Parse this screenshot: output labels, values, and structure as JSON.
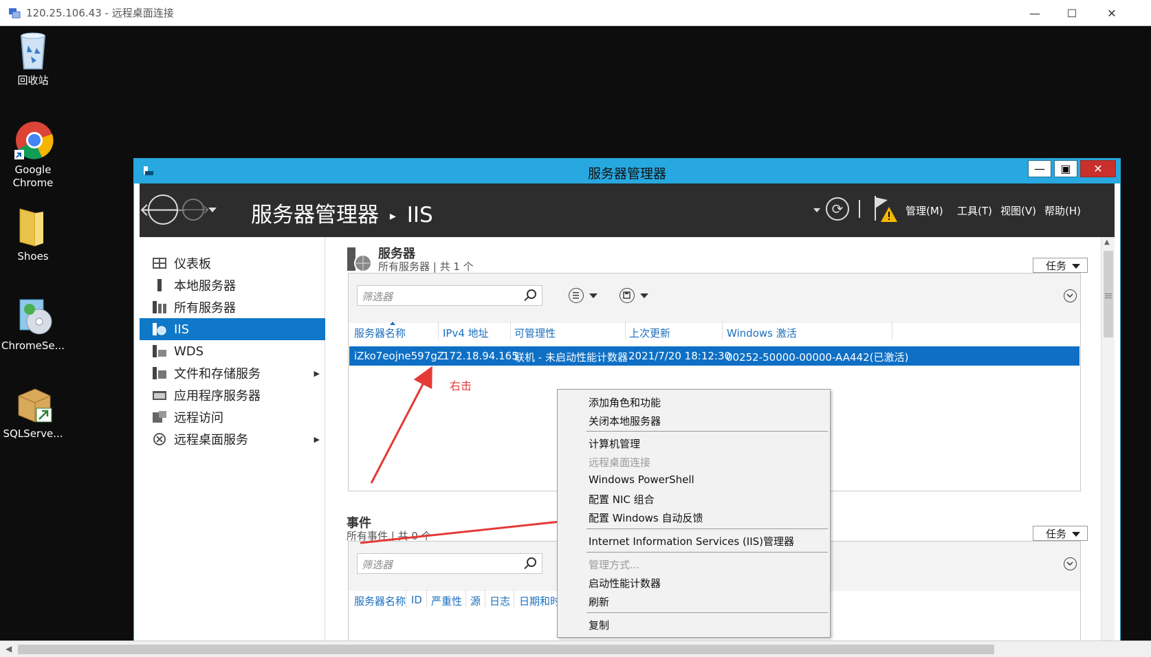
{
  "rdp": {
    "title": "120.25.106.43 - 远程桌面连接"
  },
  "desktop_icons": [
    {
      "label": "回收站",
      "icon": "recycle-bin-icon"
    },
    {
      "label": "Google\nChrome",
      "line1": "Google",
      "line2": "Chrome",
      "icon": "chrome-icon"
    },
    {
      "label": "Shoes",
      "icon": "folder-icon"
    },
    {
      "label": "ChromeSe...",
      "icon": "chromesetup-icon"
    },
    {
      "label": "SQLServe...",
      "icon": "sqlserver-icon"
    }
  ],
  "window": {
    "title": "服务器管理器"
  },
  "header": {
    "breadcrumb_root": "服务器管理器",
    "breadcrumb_sep": "▸",
    "breadcrumb_current": "IIS",
    "menu": {
      "manage": "管理(M)",
      "tools": "工具(T)",
      "view": "视图(V)",
      "help": "帮助(H)"
    }
  },
  "sidebar": {
    "items": [
      {
        "label": "仪表板",
        "icon": "dashboard-icon"
      },
      {
        "label": "本地服务器",
        "icon": "local-server-icon"
      },
      {
        "label": "所有服务器",
        "icon": "all-servers-icon"
      },
      {
        "label": "IIS",
        "icon": "iis-icon",
        "selected": true
      },
      {
        "label": "WDS",
        "icon": "wds-icon"
      },
      {
        "label": "文件和存储服务",
        "icon": "file-storage-icon",
        "expandable": true
      },
      {
        "label": "应用程序服务器",
        "icon": "app-server-icon"
      },
      {
        "label": "远程访问",
        "icon": "remote-access-icon"
      },
      {
        "label": "远程桌面服务",
        "icon": "remote-desktop-icon",
        "expandable": true
      }
    ]
  },
  "servers": {
    "title": "服务器",
    "subtitle": "所有服务器 | 共 1 个",
    "tasks": "任务",
    "filter_placeholder": "筛选器",
    "columns": [
      "服务器名称",
      "IPv4 地址",
      "可管理性",
      "上次更新",
      "Windows 激活"
    ],
    "rows": [
      {
        "name": "iZko7eojne597gZ",
        "ip": "172.18.94.165",
        "manageability": "联机 - 未启动性能计数器",
        "last_update": "2021/7/20 18:12:30",
        "activation": "00252-50000-00000-AA442(已激活)"
      }
    ]
  },
  "annotation": {
    "text": "右击",
    "color": "#e53935"
  },
  "events": {
    "title": "事件",
    "subtitle": "所有事件 | 共 0 个",
    "tasks": "任务",
    "filter_placeholder": "筛选器",
    "columns": [
      "服务器名称",
      "ID",
      "严重性",
      "源",
      "日志",
      "日期和时间"
    ]
  },
  "context_menu": {
    "items": [
      {
        "label": "添加角色和功能",
        "enabled": true
      },
      {
        "label": "关闭本地服务器",
        "enabled": true
      },
      {
        "label": "计算机管理",
        "enabled": true
      },
      {
        "label": "远程桌面连接",
        "enabled": false
      },
      {
        "label": "Windows PowerShell",
        "enabled": true
      },
      {
        "label": "配置 NIC 组合",
        "enabled": true
      },
      {
        "label": "配置 Windows 自动反馈",
        "enabled": true
      },
      {
        "label": "Internet Information Services (IIS)管理器",
        "enabled": true
      },
      {
        "label": "管理方式...",
        "enabled": false
      },
      {
        "label": "启动性能计数器",
        "enabled": true
      },
      {
        "label": "刷新",
        "enabled": true
      },
      {
        "label": "复制",
        "enabled": true
      }
    ]
  },
  "colors": {
    "accent": "#27a8e0",
    "selection": "#0e6fc4",
    "header_bg": "#2d2d2d",
    "arrow": "#e53935"
  }
}
